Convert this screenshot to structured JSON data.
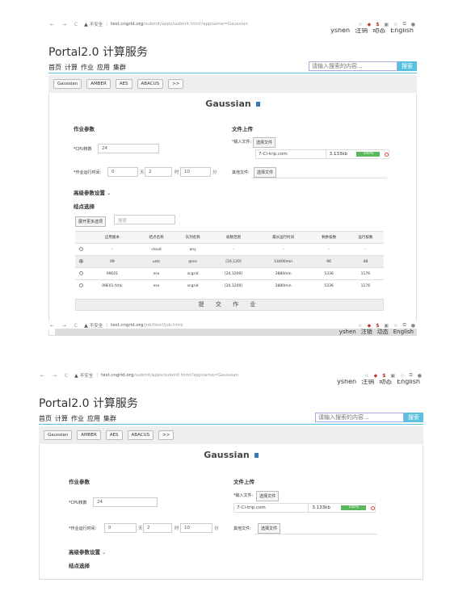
{
  "browser": {
    "nav_glyphs": "← → C",
    "warn_glyph": "▲",
    "insecure_label": "不安全",
    "separator": "|",
    "host": "test.cngrid.org",
    "path_submit": "/submit/apps/submit.html?appname=Gaussian",
    "path_job": "/job/html/job.html",
    "tool_icons": [
      "☆",
      "◆",
      "$",
      "▣",
      "☆",
      "⧉",
      "●"
    ]
  },
  "user_links": [
    "yshen",
    "注销",
    "动态",
    "English"
  ],
  "site_title": "Portal2.0 计算服务",
  "menu": [
    "首页",
    "计算",
    "作业",
    "应用",
    "集群"
  ],
  "search": {
    "placeholder": "请输入搜索的内容...",
    "button": "搜索"
  },
  "app_tabs": [
    "Gaussian",
    "AMBER",
    "AES",
    "ABACUS",
    ">>"
  ],
  "app_title": "Gaussian",
  "job_params": {
    "heading": "作业参数",
    "cpu_label": "*CPU核数",
    "cpu_value": "24",
    "time_label": "*作业运行时间:",
    "days_value": "0",
    "days_unit": "天",
    "hours_value": "2",
    "hours_unit": "时",
    "minutes_value": "10",
    "minutes_unit": "分"
  },
  "upload": {
    "heading": "文件上传",
    "input_file_label": "*输入文件:",
    "choose_button": "选择文件",
    "file_name": "7-Cl-trip.com",
    "file_size": "3.133kb",
    "progress_label": "100%",
    "progress_fraction": 1.0,
    "other_files_label": "其他文件:",
    "other_choose_button": "选择文件"
  },
  "advanced": {
    "heading": "高级参数设置",
    "chevron": "⌄"
  },
  "nodes": {
    "heading": "结点选择",
    "more_button": "展开更多选项",
    "search_placeholder": "搜索",
    "columns": [
      "",
      "应用版本",
      "结点名称",
      "队列名称",
      "核数范围",
      "最长运行时间",
      "剩余核数",
      "运行核数"
    ],
    "rows": [
      [
        "",
        "-",
        "cloud",
        "any",
        "-",
        "-",
        "-",
        "-"
      ],
      [
        "on",
        "09",
        "ustc",
        "qsce",
        "[24,120]",
        "14400min",
        "96",
        "48"
      ],
      [
        "",
        "09E01",
        "era",
        "scgrid",
        "[24,1200]",
        "2880min",
        "5336",
        "1176"
      ],
      [
        "",
        "09E01-fchk",
        "era",
        "scgrid",
        "[24,1200]",
        "2880min",
        "5336",
        "1176"
      ]
    ]
  },
  "submit_button": "提 交 作 业"
}
